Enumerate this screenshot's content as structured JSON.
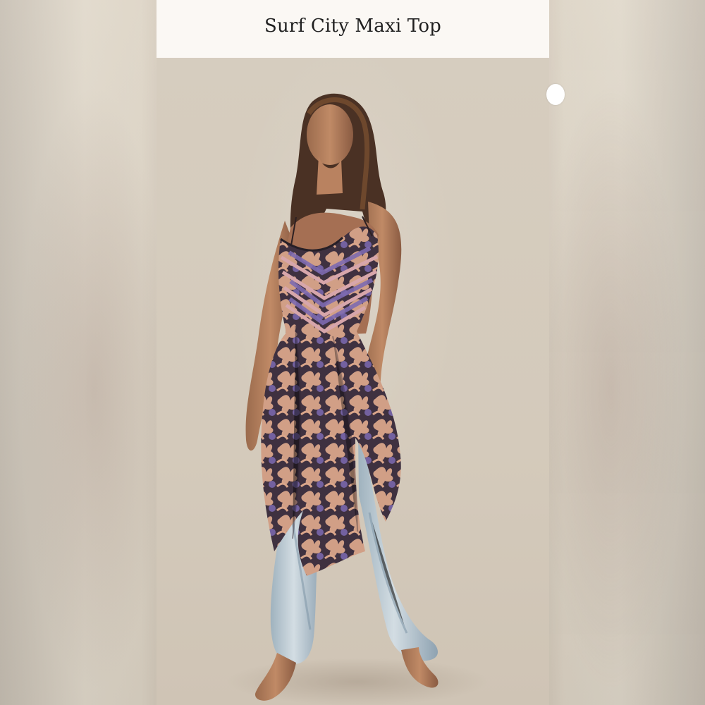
{
  "header": {
    "title": "Surf City Maxi Top"
  },
  "icons": {
    "carousel_next": "chevron-right-icon"
  },
  "colors": {
    "background": "#d9d0c2",
    "header_background": "#fbf8f4",
    "title_text": "#1f1f1f",
    "dress_dark": "#3f3140",
    "dress_floral": "#d9a58a",
    "dress_accent": "#7d6ab0",
    "jeans": "#b9c6cf"
  },
  "image": {
    "subject": "product-model-photo"
  }
}
